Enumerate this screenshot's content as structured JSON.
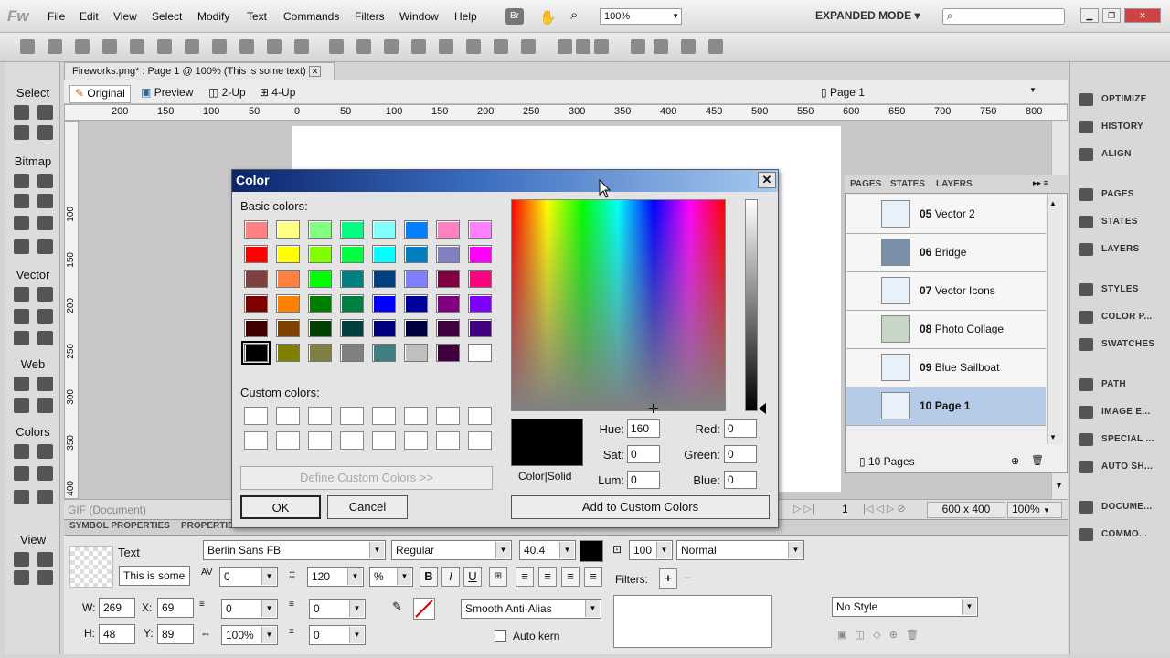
{
  "app": {
    "logo": "Fw",
    "menus": [
      "File",
      "Edit",
      "View",
      "Select",
      "Modify",
      "Text",
      "Commands",
      "Filters",
      "Window",
      "Help"
    ],
    "br_label": "Br",
    "zoom": "100%",
    "mode": "EXPANDED MODE",
    "search_placeholder": ""
  },
  "doc_tab": {
    "title": "Fireworks.png* : Page 1 @ 100% (This is some text)",
    "close": "✕"
  },
  "view_buttons": [
    "Original",
    "Preview",
    "2-Up",
    "4-Up"
  ],
  "page_select": "Page 1",
  "ruler_h": [
    "200",
    "150",
    "100",
    "50",
    "0",
    "50",
    "100",
    "150",
    "200",
    "250",
    "300",
    "350",
    "400",
    "450",
    "500",
    "550",
    "600",
    "650",
    "700",
    "750",
    "800"
  ],
  "ruler_v": [
    "100",
    "150",
    "200",
    "250",
    "300",
    "350",
    "400"
  ],
  "left_tools": {
    "sections": [
      "Select",
      "Bitmap",
      "Vector",
      "Web",
      "Colors",
      "View"
    ]
  },
  "right_panel": {
    "top": [
      "OPTIMIZE",
      "HISTORY",
      "ALIGN"
    ],
    "mid": [
      "PAGES",
      "STATES",
      "LAYERS"
    ],
    "low": [
      "STYLES",
      "COLOR P...",
      "SWATCHES"
    ],
    "bottom": [
      "PATH",
      "IMAGE E...",
      "SPECIAL ...",
      "AUTO SH..."
    ],
    "last": [
      "DOCUME...",
      "COMMO..."
    ]
  },
  "pages_panel": {
    "tabs": [
      "PAGES",
      "STATES",
      "LAYERS"
    ],
    "rows": [
      {
        "num": "05",
        "name": "Vector 2"
      },
      {
        "num": "06",
        "name": "Bridge"
      },
      {
        "num": "07",
        "name": "Vector Icons"
      },
      {
        "num": "08",
        "name": "Photo Collage"
      },
      {
        "num": "09",
        "name": "Blue Sailboat"
      },
      {
        "num": "10",
        "name": "Page 1"
      }
    ],
    "count": "10 Pages"
  },
  "color_dialog": {
    "title": "Color",
    "basic_label": "Basic colors:",
    "custom_label": "Custom colors:",
    "basic": [
      "#ff8080",
      "#ffff80",
      "#80ff80",
      "#00ff80",
      "#80ffff",
      "#0080ff",
      "#ff80c0",
      "#ff80ff",
      "#ff0000",
      "#ffff00",
      "#80ff00",
      "#00ff40",
      "#00ffff",
      "#0080c0",
      "#8080c0",
      "#ff00ff",
      "#804040",
      "#ff8040",
      "#00ff00",
      "#008080",
      "#004080",
      "#8080ff",
      "#800040",
      "#ff0080",
      "#800000",
      "#ff8000",
      "#008000",
      "#008040",
      "#0000ff",
      "#0000a0",
      "#800080",
      "#8000ff",
      "#400000",
      "#804000",
      "#004000",
      "#004040",
      "#000080",
      "#000040",
      "#400040",
      "#400080",
      "#000000",
      "#808000",
      "#808040",
      "#808080",
      "#408080",
      "#c0c0c0",
      "#400040",
      "#ffffff"
    ],
    "define_btn": "Define Custom Colors >>",
    "ok": "OK",
    "cancel": "Cancel",
    "add_btn": "Add to Custom Colors",
    "color_solid": "Color|Solid",
    "hue_label": "Hue:",
    "sat_label": "Sat:",
    "lum_label": "Lum:",
    "red_label": "Red:",
    "green_label": "Green:",
    "blue_label": "Blue:",
    "hue": "160",
    "sat": "0",
    "lum": "0",
    "red": "0",
    "green": "0",
    "blue": "0"
  },
  "status": {
    "doc_type": "GIF (Document)",
    "frame": "1",
    "size": "600 x 400",
    "zoom": "100%"
  },
  "props": {
    "tabs": [
      "SYMBOL PROPERTIES",
      "PROPERTIES"
    ],
    "type": "Text",
    "text_value": "This is some",
    "font": "Berlin Sans FB",
    "style": "Regular",
    "size": "40.4",
    "opacity": "100",
    "blend": "Normal",
    "kerning": "0",
    "leading": "120",
    "leading_unit": "%",
    "filters_label": "Filters:",
    "w_label": "W:",
    "w": "269",
    "x_label": "X:",
    "x": "69",
    "h_label": "H:",
    "h": "48",
    "y_label": "Y:",
    "y": "89",
    "indent": "0",
    "space_before": "0",
    "space_after": "0",
    "horiz_scale": "100%",
    "baseline": "0",
    "aa": "Smooth Anti-Alias",
    "autokern": "Auto kern",
    "style_sel": "No Style"
  }
}
